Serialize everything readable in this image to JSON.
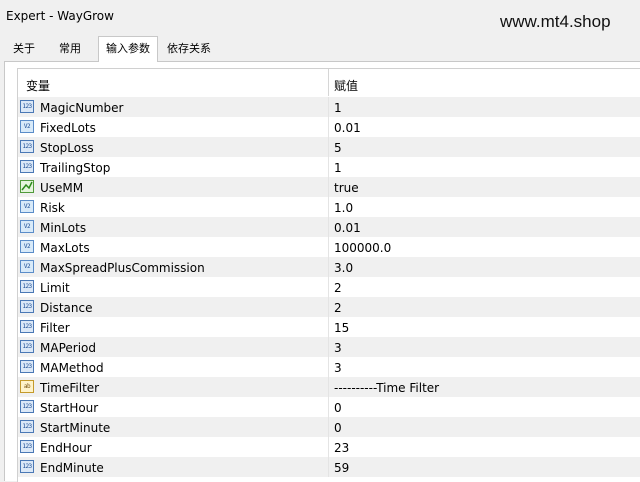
{
  "window": {
    "title": "Expert - WayGrow"
  },
  "watermark": "www.mt4.shop",
  "tabs": [
    {
      "label": "关于"
    },
    {
      "label": "常用"
    },
    {
      "label": "输入参数",
      "active": true
    },
    {
      "label": "依存关系"
    }
  ],
  "table": {
    "columns": [
      "变量",
      "赋值"
    ],
    "rows": [
      {
        "icon": "int-icon",
        "icon_text": "123",
        "name": "MagicNumber",
        "value": "1"
      },
      {
        "icon": "double-icon",
        "icon_text": "V2",
        "name": "FixedLots",
        "value": "0.01"
      },
      {
        "icon": "int-icon",
        "icon_text": "123",
        "name": "StopLoss",
        "value": "5"
      },
      {
        "icon": "int-icon",
        "icon_text": "123",
        "name": "TrailingStop",
        "value": "1"
      },
      {
        "icon": "bool-icon",
        "icon_text": "",
        "name": "UseMM",
        "value": "true"
      },
      {
        "icon": "double-icon",
        "icon_text": "V2",
        "name": "Risk",
        "value": "1.0"
      },
      {
        "icon": "double-icon",
        "icon_text": "V2",
        "name": "MinLots",
        "value": "0.01"
      },
      {
        "icon": "double-icon",
        "icon_text": "V2",
        "name": "MaxLots",
        "value": "100000.0"
      },
      {
        "icon": "double-icon",
        "icon_text": "V2",
        "name": "MaxSpreadPlusCommission",
        "value": "3.0"
      },
      {
        "icon": "int-icon",
        "icon_text": "123",
        "name": "Limit",
        "value": "2"
      },
      {
        "icon": "int-icon",
        "icon_text": "123",
        "name": "Distance",
        "value": "2"
      },
      {
        "icon": "int-icon",
        "icon_text": "123",
        "name": "Filter",
        "value": "15"
      },
      {
        "icon": "int-icon",
        "icon_text": "123",
        "name": "MAPeriod",
        "value": "3"
      },
      {
        "icon": "int-icon",
        "icon_text": "123",
        "name": "MAMethod",
        "value": "3"
      },
      {
        "icon": "string-icon",
        "icon_text": "ab",
        "name": "TimeFilter",
        "value": "----------Time Filter"
      },
      {
        "icon": "int-icon",
        "icon_text": "123",
        "name": "StartHour",
        "value": "0"
      },
      {
        "icon": "int-icon",
        "icon_text": "123",
        "name": "StartMinute",
        "value": "0"
      },
      {
        "icon": "int-icon",
        "icon_text": "123",
        "name": "EndHour",
        "value": "23"
      },
      {
        "icon": "int-icon",
        "icon_text": "123",
        "name": "EndMinute",
        "value": "59"
      }
    ]
  }
}
